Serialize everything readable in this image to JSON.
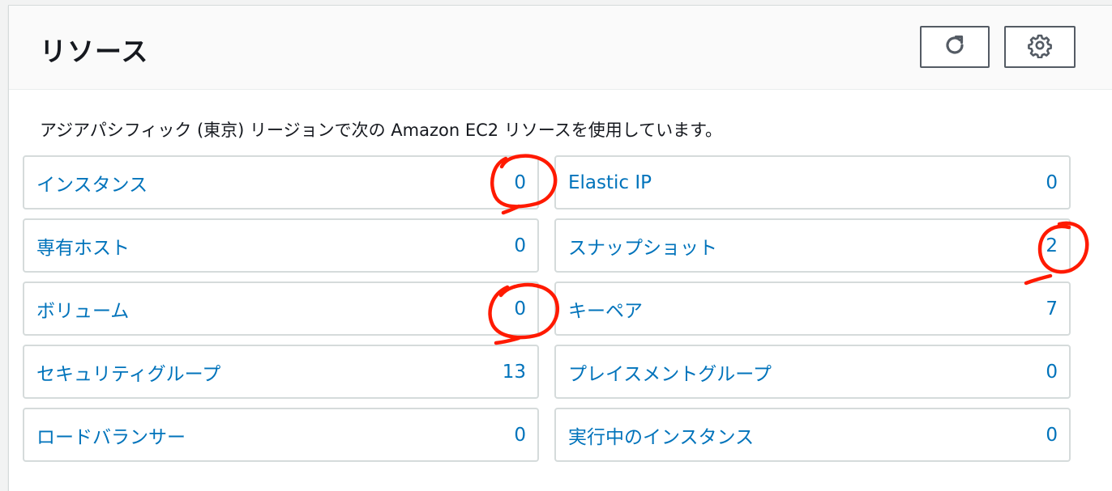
{
  "header": {
    "title": "リソース",
    "refresh_icon": "refresh-icon",
    "settings_icon": "gear-icon"
  },
  "description": "アジアパシフィック (東京) リージョンで次の Amazon EC2 リソースを使用しています。",
  "colors": {
    "link": "#0073bb",
    "annotation": "#ff1a00"
  },
  "resources": [
    {
      "label": "インスタンス",
      "count": "0"
    },
    {
      "label": "Elastic IP",
      "count": "0"
    },
    {
      "label": "専有ホスト",
      "count": "0"
    },
    {
      "label": "スナップショット",
      "count": "2"
    },
    {
      "label": "ボリューム",
      "count": "0"
    },
    {
      "label": "キーペア",
      "count": "7"
    },
    {
      "label": "セキュリティグループ",
      "count": "13"
    },
    {
      "label": "プレイスメントグループ",
      "count": "0"
    },
    {
      "label": "ロードバランサー",
      "count": "0"
    },
    {
      "label": "実行中のインスタンス",
      "count": "0"
    }
  ]
}
